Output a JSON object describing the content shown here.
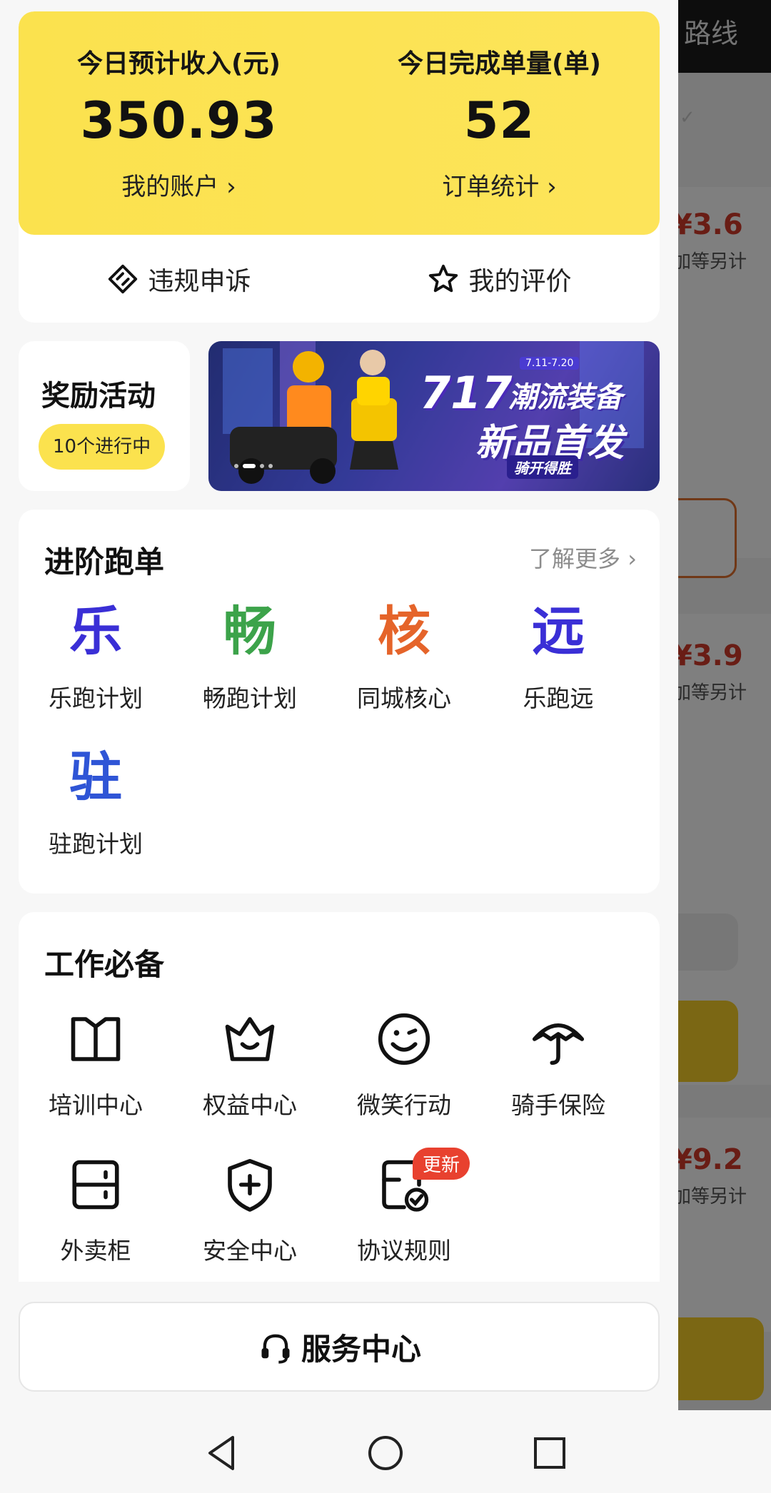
{
  "background_app": {
    "route_label": "路线",
    "cards": [
      {
        "price": "¥3.6",
        "sub": "加等另计"
      },
      {
        "price": "¥3.9",
        "sub": "加等另计"
      },
      {
        "price": "¥9.2",
        "sub": "加等另计"
      }
    ]
  },
  "summary": {
    "income_label": "今日预计收入(元)",
    "income_value": "350.93",
    "account_link": "我的账户 ›",
    "orders_label": "今日完成单量(单)",
    "orders_value": "52",
    "orders_link": "订单统计 ›"
  },
  "quick_actions": {
    "appeal": "违规申诉",
    "reviews": "我的评价"
  },
  "rewards": {
    "title": "奖励活动",
    "badge": "10个进行中"
  },
  "banner": {
    "number": "717",
    "line1": "潮流装备",
    "line2": "新品首发",
    "line3": "骑开得胜",
    "date": "7.11-7.20"
  },
  "advanced": {
    "title": "进阶跑单",
    "more": "了解更多 ›",
    "items": [
      {
        "char": "乐",
        "label": "乐跑计划",
        "color": "#3a2fd6"
      },
      {
        "char": "畅",
        "label": "畅跑计划",
        "color": "#3ca34a"
      },
      {
        "char": "核",
        "label": "同城核心",
        "color": "#e5642a"
      },
      {
        "char": "远",
        "label": "乐跑远",
        "color": "#3a2fd6"
      },
      {
        "char": "驻",
        "label": "驻跑计划",
        "color": "#2f55d6"
      }
    ]
  },
  "essentials": {
    "title": "工作必备",
    "items": [
      {
        "label": "培训中心",
        "icon": "book-icon"
      },
      {
        "label": "权益中心",
        "icon": "crown-icon"
      },
      {
        "label": "微笑行动",
        "icon": "smile-icon"
      },
      {
        "label": "骑手保险",
        "icon": "umbrella-icon"
      },
      {
        "label": "外卖柜",
        "icon": "locker-icon"
      },
      {
        "label": "安全中心",
        "icon": "shield-icon"
      },
      {
        "label": "协议规则",
        "icon": "agreement-icon",
        "badge": "更新"
      }
    ]
  },
  "service": {
    "label": "服务中心"
  }
}
